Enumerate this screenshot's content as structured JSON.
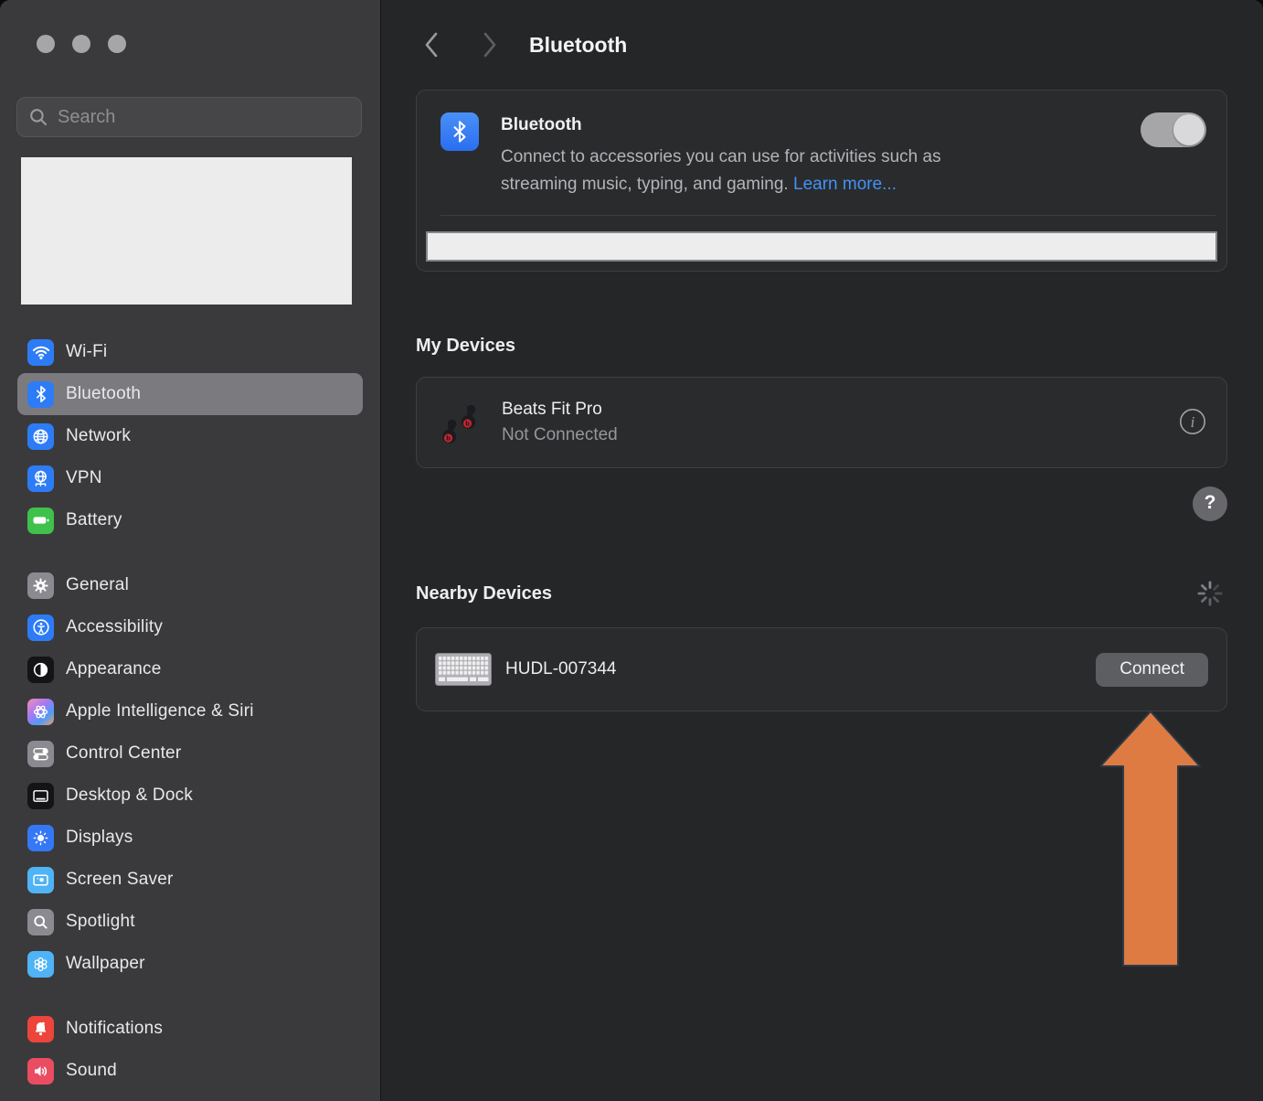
{
  "window": {
    "traffic_lights": [
      "close",
      "minimize",
      "zoom"
    ]
  },
  "sidebar": {
    "search": {
      "placeholder": "Search",
      "icon": "search-icon"
    },
    "groups": [
      {
        "items": [
          {
            "label": "Wi-Fi",
            "icon": "wifi",
            "bg": "#2d7cf6"
          },
          {
            "label": "Bluetooth",
            "icon": "bluetooth",
            "bg": "#2d7cf6",
            "selected": true
          },
          {
            "label": "Network",
            "icon": "network-globe",
            "bg": "#2d7cf6"
          },
          {
            "label": "VPN",
            "icon": "vpn-globe",
            "bg": "#2d7cf6"
          },
          {
            "label": "Battery",
            "icon": "battery",
            "bg": "#3fc14c"
          }
        ]
      },
      {
        "items": [
          {
            "label": "General",
            "icon": "gear",
            "bg": "#8a8a90"
          },
          {
            "label": "Accessibility",
            "icon": "accessibility",
            "bg": "#2d7cf6"
          },
          {
            "label": "Appearance",
            "icon": "appearance",
            "bg": "#141416"
          },
          {
            "label": "Apple Intelligence & Siri",
            "icon": "apple-intelligence",
            "bg": "linear-gradient(140deg,#f58fb3 0%,#a678f2 40%,#4f9cf7 70%,#f0a05c 100%)"
          },
          {
            "label": "Control Center",
            "icon": "control-center",
            "bg": "#8a8a90"
          },
          {
            "label": "Desktop & Dock",
            "icon": "desktop-dock",
            "bg": "#141416"
          },
          {
            "label": "Displays",
            "icon": "displays",
            "bg": "#3478f6"
          },
          {
            "label": "Screen Saver",
            "icon": "screen-saver",
            "bg": "#4fb3f5"
          },
          {
            "label": "Spotlight",
            "icon": "spotlight",
            "bg": "#8a8a90"
          },
          {
            "label": "Wallpaper",
            "icon": "wallpaper",
            "bg": "#4fb3f5"
          }
        ]
      },
      {
        "items": [
          {
            "label": "Notifications",
            "icon": "notifications",
            "bg": "#ec453c"
          },
          {
            "label": "Sound",
            "icon": "sound",
            "bg": "#ea4c62"
          }
        ]
      }
    ]
  },
  "header": {
    "title": "Bluetooth",
    "back_icon": "chevron-left-icon",
    "forward_icon": "chevron-right-icon"
  },
  "bluetooth_card": {
    "icon": "bluetooth-app-icon",
    "title": "Bluetooth",
    "description_line1": "Connect to accessories you can use for activities such as",
    "description_line2": "streaming music, typing, and gaming.",
    "learn_more": "Learn more...",
    "toggle": {
      "state": "on"
    }
  },
  "my_devices": {
    "heading": "My Devices",
    "devices": [
      {
        "name": "Beats Fit Pro",
        "status": "Not Connected",
        "icon": "beats-earbuds",
        "info_icon": "info-icon"
      }
    ]
  },
  "help_button": {
    "label": "?"
  },
  "nearby_devices": {
    "heading": "Nearby Devices",
    "spinner_icon": "loading-spinner",
    "devices": [
      {
        "name": "HUDL-007344",
        "icon": "keyboard",
        "action": "Connect"
      }
    ]
  },
  "annotation": {
    "shape": "up-arrow",
    "color": "#dd7b42",
    "points_at": "Connect"
  },
  "colors": {
    "accent_blue": "#2d7cf6",
    "link_blue": "#4193f8",
    "annotation_orange": "#dd7b42",
    "sidebar_bg": "#3a3a3c",
    "content_bg": "#252628",
    "card_bg": "#2a2b2d"
  }
}
